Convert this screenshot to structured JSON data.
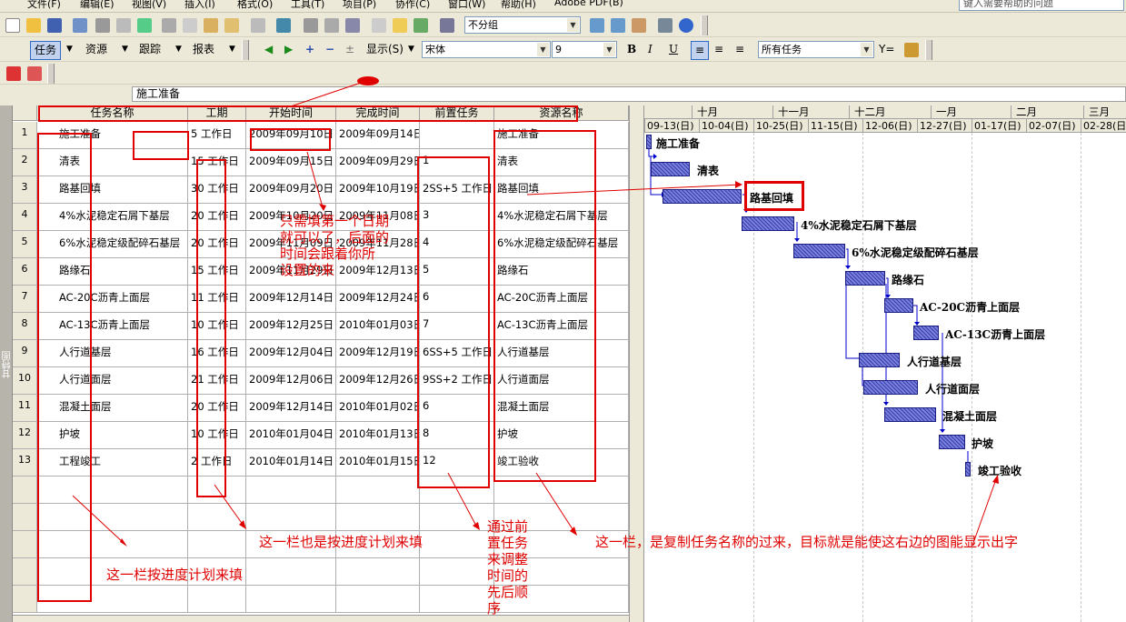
{
  "menu": [
    "文件(F)",
    "编辑(E)",
    "视图(V)",
    "插入(I)",
    "格式(O)",
    "工具(T)",
    "项目(P)",
    "协作(C)",
    "窗口(W)",
    "帮助(H)",
    "Adobe PDF(B)"
  ],
  "help_placeholder": "键入需要帮助的问题",
  "toolbar1": {
    "group_select": "不分组"
  },
  "toolbar2": {
    "tasks_btn": "任务",
    "resources_btn": "资源",
    "track_btn": "跟踪",
    "report_btn": "报表",
    "show_btn": "显示(S)",
    "font": "宋体",
    "font_size": "9",
    "bold": "B",
    "italic": "I",
    "underline": "U",
    "filter": "所有任务"
  },
  "entry_value": "施工准备",
  "side_label": "甘特图",
  "columns": [
    "任务名称",
    "工期",
    "开始时间",
    "完成时间",
    "前置任务",
    "资源名称"
  ],
  "rows": [
    {
      "id": "1",
      "name": "施工准备",
      "dur": "5 工作日",
      "start": "2009年09月10日",
      "finish": "2009年09月14日",
      "pred": "",
      "res": "施工准备"
    },
    {
      "id": "2",
      "name": "清表",
      "dur": "15 工作日",
      "start": "2009年09月15日",
      "finish": "2009年09月29日",
      "pred": "1",
      "res": "清表"
    },
    {
      "id": "3",
      "name": "路基回填",
      "dur": "30 工作日",
      "start": "2009年09月20日",
      "finish": "2009年10月19日",
      "pred": "2SS+5 工作日",
      "res": "路基回填"
    },
    {
      "id": "4",
      "name": "4%水泥稳定石屑下基层",
      "dur": "20 工作日",
      "start": "2009年10月20日",
      "finish": "2009年11月08日",
      "pred": "3",
      "res": "4%水泥稳定石屑下基层"
    },
    {
      "id": "5",
      "name": "6%水泥稳定级配碎石基层",
      "dur": "20 工作日",
      "start": "2009年11月09日",
      "finish": "2009年11月28日",
      "pred": "4",
      "res": "6%水泥稳定级配碎石基层"
    },
    {
      "id": "6",
      "name": "路缘石",
      "dur": "15 工作日",
      "start": "2009年11月29日",
      "finish": "2009年12月13日",
      "pred": "5",
      "res": "路缘石"
    },
    {
      "id": "7",
      "name": "AC-20C沥青上面层",
      "dur": "11 工作日",
      "start": "2009年12月14日",
      "finish": "2009年12月24日",
      "pred": "6",
      "res": "AC-20C沥青上面层"
    },
    {
      "id": "8",
      "name": "AC-13C沥青上面层",
      "dur": "10 工作日",
      "start": "2009年12月25日",
      "finish": "2010年01月03日",
      "pred": "7",
      "res": "AC-13C沥青上面层"
    },
    {
      "id": "9",
      "name": "人行道基层",
      "dur": "16 工作日",
      "start": "2009年12月04日",
      "finish": "2009年12月19日",
      "pred": "6SS+5 工作日",
      "res": "人行道基层"
    },
    {
      "id": "10",
      "name": "人行道面层",
      "dur": "21 工作日",
      "start": "2009年12月06日",
      "finish": "2009年12月26日",
      "pred": "9SS+2 工作日",
      "res": "人行道面层"
    },
    {
      "id": "11",
      "name": "混凝土面层",
      "dur": "20 工作日",
      "start": "2009年12月14日",
      "finish": "2010年01月02日",
      "pred": "6",
      "res": "混凝土面层"
    },
    {
      "id": "12",
      "name": "护坡",
      "dur": "10 工作日",
      "start": "2010年01月04日",
      "finish": "2010年01月13日",
      "pred": "8",
      "res": "护坡"
    },
    {
      "id": "13",
      "name": "工程竣工",
      "dur": "2 工作日",
      "start": "2010年01月14日",
      "finish": "2010年01月15日",
      "pred": "12",
      "res": "竣工验收"
    }
  ],
  "gantt": {
    "top": [
      "十月",
      "十一月",
      "十二月",
      "一月",
      "二月",
      "三月"
    ],
    "bottom": [
      "09-13(日)",
      "10-04(日)",
      "10-25(日)",
      "11-15(日)",
      "12-06(日)",
      "12-27(日)",
      "01-17(日)",
      "02-07(日)",
      "02-28(日)"
    ],
    "labels": [
      "施工准备",
      "清表",
      "路基回填",
      "4%水泥稳定石屑下基层",
      "6%水泥稳定级配碎石基层",
      "路缘石",
      "AC-20C沥青上面层",
      "AC-13C沥青上面层",
      "人行道基层",
      "人行道面层",
      "混凝土面层",
      "护坡",
      "竣工验收"
    ]
  },
  "notes": {
    "n1": "这一栏按进度计划来填",
    "n2": "这一栏也是按进度计划来填",
    "n3a": "通过前",
    "n3b": "置任务",
    "n3c": "来调整",
    "n3d": "时间的",
    "n3e": "先后顺",
    "n3f": "序",
    "n4": "这一栏，是复制任务名称的过来，目标就是能使这右边的图能显示出字",
    "n5a": "只需填第一个日期",
    "n5b": "就可以了，后面的",
    "n5c": "时间会跟着你所",
    "n5d": "设置的来"
  }
}
